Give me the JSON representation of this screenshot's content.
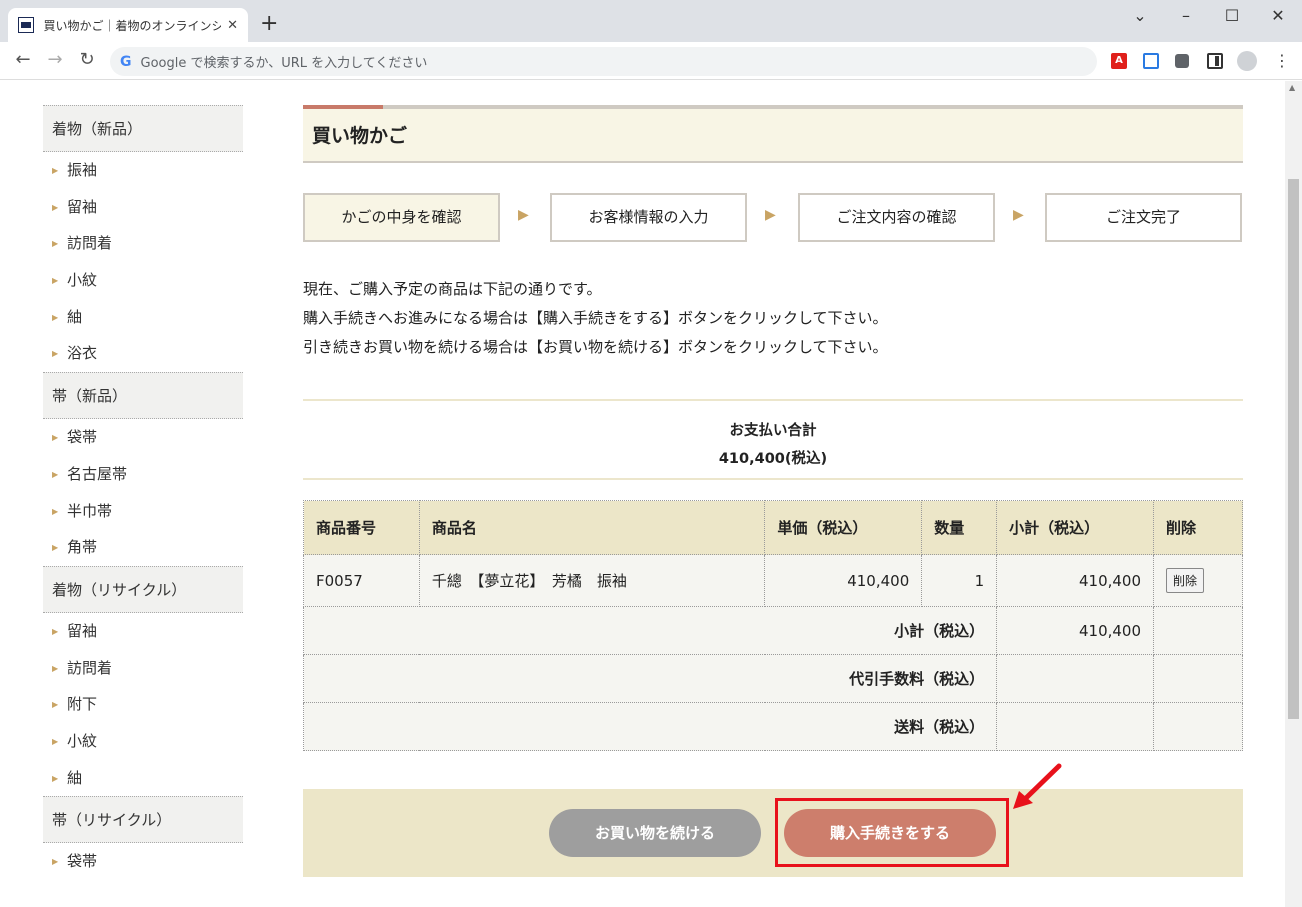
{
  "browser": {
    "tab_title": "買い物かご｜着物のオンラインショップ",
    "tab_close": "✕",
    "new_tab": "+",
    "omnibox_placeholder": "Google で検索するか、URL を入力してください"
  },
  "sidebar": {
    "groups": [
      {
        "label": "着物（新品）",
        "items": [
          "振袖",
          "留袖",
          "訪問着",
          "小紋",
          "紬",
          "浴衣"
        ]
      },
      {
        "label": "帯（新品）",
        "items": [
          "袋帯",
          "名古屋帯",
          "半巾帯",
          "角帯"
        ]
      },
      {
        "label": "着物（リサイクル）",
        "items": [
          "留袖",
          "訪問着",
          "附下",
          "小紋",
          "紬"
        ]
      },
      {
        "label": "帯（リサイクル）",
        "items": [
          "袋帯"
        ]
      }
    ]
  },
  "page": {
    "title": "買い物かご",
    "steps": [
      "かごの中身を確認",
      "お客様情報の入力",
      "ご注文内容の確認",
      "ご注文完了"
    ],
    "active_step": 0,
    "intro": [
      "現在、ご購入予定の商品は下記の通りです。",
      "購入手続きへお進みになる場合は【購入手続きをする】ボタンをクリックして下さい。",
      "引き続きお買い物を続ける場合は【お買い物を続ける】ボタンをクリックして下さい。"
    ],
    "total_label": "お支払い合計",
    "total_value": "410,400(税込)"
  },
  "cart": {
    "headers": [
      "商品番号",
      "商品名",
      "単価（税込）",
      "数量",
      "小計（税込）",
      "削除"
    ],
    "items": [
      {
        "code": "F0057",
        "name": "千總　【夢立花】　芳橘　振袖",
        "unit_price": "410,400",
        "qty": "1",
        "subtotal": "410,400",
        "delete_label": "削除"
      }
    ],
    "summary": [
      {
        "label": "小計（税込）",
        "value": "410,400"
      },
      {
        "label": "代引手数料（税込）",
        "value": ""
      },
      {
        "label": "送料（税込）",
        "value": ""
      }
    ]
  },
  "actions": {
    "continue_label": "お買い物を続ける",
    "checkout_label": "購入手続きをする"
  },
  "colors": {
    "accent": "#cd7e6c",
    "header_fill": "#ece6c8",
    "annotation": "#e8111b"
  }
}
